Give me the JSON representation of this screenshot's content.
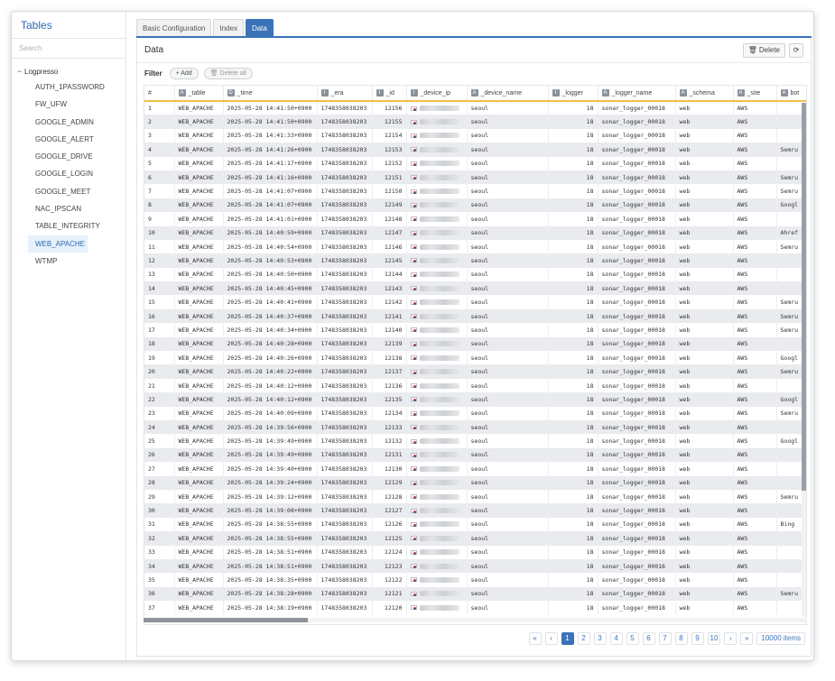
{
  "sidebar": {
    "title": "Tables",
    "search_placeholder": "Search",
    "root": "Logpresso",
    "items": [
      "AUTH_1PASSWORD",
      "FW_UFW",
      "GOOGLE_ADMIN",
      "GOOGLE_ALERT",
      "GOOGLE_DRIVE",
      "GOOGLE_LOGIN",
      "GOOGLE_MEET",
      "NAC_IPSCAN",
      "TABLE_INTEGRITY",
      "WEB_APACHE",
      "WTMP"
    ],
    "active_item": "WEB_APACHE"
  },
  "tabs": [
    "Basic Configuration",
    "Index",
    "Data"
  ],
  "active_tab": "Data",
  "panel": {
    "title": "Data",
    "delete_label": "Delete",
    "filter_label": "Filter",
    "add_label": "Add",
    "delete_all_label": "Delete all"
  },
  "table": {
    "columns": [
      {
        "label": "#",
        "type": ""
      },
      {
        "label": "_table",
        "type": "A"
      },
      {
        "label": "_time",
        "type": "D"
      },
      {
        "label": "_era",
        "type": "I"
      },
      {
        "label": "_id",
        "type": "I"
      },
      {
        "label": "_device_ip",
        "type": "I"
      },
      {
        "label": "_device_name",
        "type": "A"
      },
      {
        "label": "_logger",
        "type": "I"
      },
      {
        "label": "_logger_name",
        "type": "A"
      },
      {
        "label": "_schema",
        "type": "A"
      },
      {
        "label": "_site",
        "type": "A"
      },
      {
        "label": "bot",
        "type": "A"
      }
    ],
    "rows": [
      [
        "1",
        "WEB_APACHE",
        "2025-05-28 14:41:50+0900",
        "1748358038203",
        "12156",
        "",
        "seoul",
        "18",
        "sonar_logger_00018",
        "web",
        "AWS",
        ""
      ],
      [
        "2",
        "WEB_APACHE",
        "2025-05-28 14:41:50+0900",
        "1748358038203",
        "12155",
        "",
        "seoul",
        "18",
        "sonar_logger_00018",
        "web",
        "AWS",
        ""
      ],
      [
        "3",
        "WEB_APACHE",
        "2025-05-28 14:41:33+0900",
        "1748358038203",
        "12154",
        "",
        "seoul",
        "18",
        "sonar_logger_00018",
        "web",
        "AWS",
        ""
      ],
      [
        "4",
        "WEB_APACHE",
        "2025-05-28 14:41:26+0900",
        "1748358038203",
        "12153",
        "",
        "seoul",
        "18",
        "sonar_logger_00018",
        "web",
        "AWS",
        "Semru"
      ],
      [
        "5",
        "WEB_APACHE",
        "2025-05-28 14:41:17+0900",
        "1748358038203",
        "12152",
        "",
        "seoul",
        "18",
        "sonar_logger_00018",
        "web",
        "AWS",
        ""
      ],
      [
        "6",
        "WEB_APACHE",
        "2025-05-28 14:41:16+0900",
        "1748358038203",
        "12151",
        "",
        "seoul",
        "18",
        "sonar_logger_00018",
        "web",
        "AWS",
        "Semru"
      ],
      [
        "7",
        "WEB_APACHE",
        "2025-05-28 14:41:07+0900",
        "1748358038203",
        "12150",
        "",
        "seoul",
        "18",
        "sonar_logger_00018",
        "web",
        "AWS",
        "Semru"
      ],
      [
        "8",
        "WEB_APACHE",
        "2025-05-28 14:41:07+0900",
        "1748358038203",
        "12149",
        "",
        "seoul",
        "18",
        "sonar_logger_00018",
        "web",
        "AWS",
        "Googl"
      ],
      [
        "9",
        "WEB_APACHE",
        "2025-05-28 14:41:01+0900",
        "1748358038203",
        "12148",
        "",
        "seoul",
        "18",
        "sonar_logger_00018",
        "web",
        "AWS",
        ""
      ],
      [
        "10",
        "WEB_APACHE",
        "2025-05-28 14:40:59+0900",
        "1748358038203",
        "12147",
        "",
        "seoul",
        "18",
        "sonar_logger_00018",
        "web",
        "AWS",
        "Ahref"
      ],
      [
        "11",
        "WEB_APACHE",
        "2025-05-28 14:40:54+0900",
        "1748358038203",
        "12146",
        "",
        "seoul",
        "18",
        "sonar_logger_00018",
        "web",
        "AWS",
        "Semru"
      ],
      [
        "12",
        "WEB_APACHE",
        "2025-05-28 14:40:53+0900",
        "1748358038203",
        "12145",
        "",
        "seoul",
        "18",
        "sonar_logger_00018",
        "web",
        "AWS",
        ""
      ],
      [
        "13",
        "WEB_APACHE",
        "2025-05-28 14:40:50+0900",
        "1748358038203",
        "12144",
        "",
        "seoul",
        "18",
        "sonar_logger_00018",
        "web",
        "AWS",
        ""
      ],
      [
        "14",
        "WEB_APACHE",
        "2025-05-28 14:40:45+0900",
        "1748358038203",
        "12143",
        "",
        "seoul",
        "18",
        "sonar_logger_00018",
        "web",
        "AWS",
        ""
      ],
      [
        "15",
        "WEB_APACHE",
        "2025-05-28 14:40:41+0900",
        "1748358038203",
        "12142",
        "",
        "seoul",
        "18",
        "sonar_logger_00018",
        "web",
        "AWS",
        "Semru"
      ],
      [
        "16",
        "WEB_APACHE",
        "2025-05-28 14:40:37+0900",
        "1748358038203",
        "12141",
        "",
        "seoul",
        "18",
        "sonar_logger_00018",
        "web",
        "AWS",
        "Semru"
      ],
      [
        "17",
        "WEB_APACHE",
        "2025-05-28 14:40:34+0900",
        "1748358038203",
        "12140",
        "",
        "seoul",
        "18",
        "sonar_logger_00018",
        "web",
        "AWS",
        "Semru"
      ],
      [
        "18",
        "WEB_APACHE",
        "2025-05-28 14:40:28+0900",
        "1748358038203",
        "12139",
        "",
        "seoul",
        "18",
        "sonar_logger_00018",
        "web",
        "AWS",
        ""
      ],
      [
        "19",
        "WEB_APACHE",
        "2025-05-28 14:40:26+0900",
        "1748358038203",
        "12138",
        "",
        "seoul",
        "18",
        "sonar_logger_00018",
        "web",
        "AWS",
        "Googl"
      ],
      [
        "20",
        "WEB_APACHE",
        "2025-05-28 14:40:22+0900",
        "1748358038203",
        "12137",
        "",
        "seoul",
        "18",
        "sonar_logger_00018",
        "web",
        "AWS",
        "Semru"
      ],
      [
        "21",
        "WEB_APACHE",
        "2025-05-28 14:40:12+0900",
        "1748358038203",
        "12136",
        "",
        "seoul",
        "18",
        "sonar_logger_00018",
        "web",
        "AWS",
        ""
      ],
      [
        "22",
        "WEB_APACHE",
        "2025-05-28 14:40:12+0900",
        "1748358038203",
        "12135",
        "",
        "seoul",
        "18",
        "sonar_logger_00018",
        "web",
        "AWS",
        "Googl"
      ],
      [
        "23",
        "WEB_APACHE",
        "2025-05-28 14:40:09+0900",
        "1748358038203",
        "12134",
        "",
        "seoul",
        "18",
        "sonar_logger_00018",
        "web",
        "AWS",
        "Semru"
      ],
      [
        "24",
        "WEB_APACHE",
        "2025-05-28 14:39:56+0900",
        "1748358038203",
        "12133",
        "",
        "seoul",
        "18",
        "sonar_logger_00018",
        "web",
        "AWS",
        ""
      ],
      [
        "25",
        "WEB_APACHE",
        "2025-05-28 14:39:49+0900",
        "1748358038203",
        "12132",
        "",
        "seoul",
        "18",
        "sonar_logger_00018",
        "web",
        "AWS",
        "Googl"
      ],
      [
        "26",
        "WEB_APACHE",
        "2025-05-28 14:39:49+0900",
        "1748358038203",
        "12131",
        "",
        "seoul",
        "18",
        "sonar_logger_00018",
        "web",
        "AWS",
        ""
      ],
      [
        "27",
        "WEB_APACHE",
        "2025-05-28 14:39:40+0900",
        "1748358038203",
        "12130",
        "",
        "seoul",
        "18",
        "sonar_logger_00018",
        "web",
        "AWS",
        ""
      ],
      [
        "28",
        "WEB_APACHE",
        "2025-05-28 14:39:24+0900",
        "1748358038203",
        "12129",
        "",
        "seoul",
        "18",
        "sonar_logger_00018",
        "web",
        "AWS",
        ""
      ],
      [
        "29",
        "WEB_APACHE",
        "2025-05-28 14:39:12+0900",
        "1748358038203",
        "12128",
        "",
        "seoul",
        "18",
        "sonar_logger_00018",
        "web",
        "AWS",
        "Semru"
      ],
      [
        "30",
        "WEB_APACHE",
        "2025-05-28 14:39:08+0900",
        "1748358038203",
        "12127",
        "",
        "seoul",
        "18",
        "sonar_logger_00018",
        "web",
        "AWS",
        ""
      ],
      [
        "31",
        "WEB_APACHE",
        "2025-05-28 14:38:55+0900",
        "1748358038203",
        "12126",
        "",
        "seoul",
        "18",
        "sonar_logger_00018",
        "web",
        "AWS",
        "Bing"
      ],
      [
        "32",
        "WEB_APACHE",
        "2025-05-28 14:38:55+0900",
        "1748358038203",
        "12125",
        "",
        "seoul",
        "18",
        "sonar_logger_00018",
        "web",
        "AWS",
        ""
      ],
      [
        "33",
        "WEB_APACHE",
        "2025-05-28 14:38:51+0900",
        "1748358038203",
        "12124",
        "",
        "seoul",
        "18",
        "sonar_logger_00018",
        "web",
        "AWS",
        ""
      ],
      [
        "34",
        "WEB_APACHE",
        "2025-05-28 14:38:51+0900",
        "1748358038203",
        "12123",
        "",
        "seoul",
        "18",
        "sonar_logger_00018",
        "web",
        "AWS",
        ""
      ],
      [
        "35",
        "WEB_APACHE",
        "2025-05-28 14:38:35+0900",
        "1748358038203",
        "12122",
        "",
        "seoul",
        "18",
        "sonar_logger_00018",
        "web",
        "AWS",
        ""
      ],
      [
        "36",
        "WEB_APACHE",
        "2025-05-28 14:38:28+0900",
        "1748358038203",
        "12121",
        "",
        "seoul",
        "18",
        "sonar_logger_00018",
        "web",
        "AWS",
        "Semru"
      ],
      [
        "37",
        "WEB_APACHE",
        "2025-05-28 14:38:19+0900",
        "1748358038203",
        "12120",
        "",
        "seoul",
        "18",
        "sonar_logger_00018",
        "web",
        "AWS",
        ""
      ]
    ]
  },
  "pagination": {
    "first": "«",
    "prev": "‹",
    "pages": [
      "1",
      "2",
      "3",
      "4",
      "5",
      "6",
      "7",
      "8",
      "9",
      "10"
    ],
    "current": "1",
    "next": "›",
    "last": "»",
    "total": "10000 items"
  },
  "icons": {
    "delete": "trash-icon",
    "refresh": "refresh-icon",
    "add": "plus-icon",
    "delete_all": "trash-icon",
    "flag": "korea-flag-icon"
  }
}
